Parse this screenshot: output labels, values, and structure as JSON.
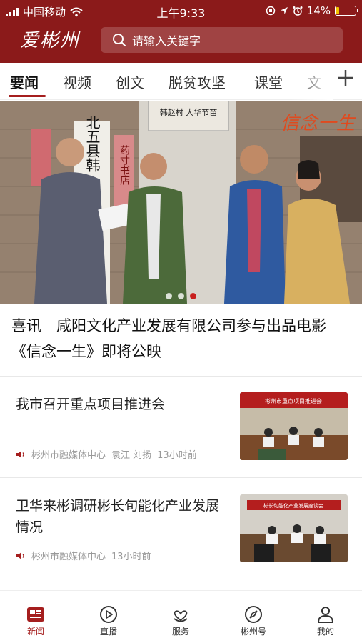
{
  "status": {
    "carrier": "中国移动",
    "time": "上午9:33",
    "battery": "14%",
    "battery_level": 0.14
  },
  "header": {
    "logo_text": "爱彬州",
    "search_placeholder": "请输入关键字"
  },
  "tabs": [
    {
      "label": "要闻",
      "active": true
    },
    {
      "label": "视频"
    },
    {
      "label": "创文"
    },
    {
      "label": "脱贫攻坚"
    },
    {
      "label": "课堂"
    },
    {
      "label": "文"
    }
  ],
  "banner": {
    "sign_left": "北五县韩",
    "sign_poster": "韩赵村 大华节苗",
    "sign_red": "药寸书店",
    "logo_text": "信念一生",
    "slide_count": 3,
    "active_slide": 3
  },
  "headline": "喜讯｜咸阳文化产业发展有限公司参与出品电影《信念一生》即将公映",
  "news": [
    {
      "title": "我市召开重点项目推进会",
      "source": "彬州市融媒体中心",
      "authors": "袁江  刘扬",
      "time": "13小时前",
      "thumb_banner": "彬州市重点项目推进会"
    },
    {
      "title": "卫华来彬调研彬长旬能化产业发展情况",
      "source": "彬州市融媒体中心",
      "authors": "",
      "time": "13小时前",
      "thumb_banner": "彬长旬能化产业发展座谈会"
    }
  ],
  "nav": [
    {
      "label": "新闻",
      "icon": "news-icon",
      "active": true
    },
    {
      "label": "直播",
      "icon": "play-icon"
    },
    {
      "label": "服务",
      "icon": "service-icon"
    },
    {
      "label": "彬州号",
      "icon": "compass-icon"
    },
    {
      "label": "我的",
      "icon": "user-icon"
    }
  ],
  "colors": {
    "brand": "#8b1a1a",
    "accent": "#a51e1e"
  }
}
